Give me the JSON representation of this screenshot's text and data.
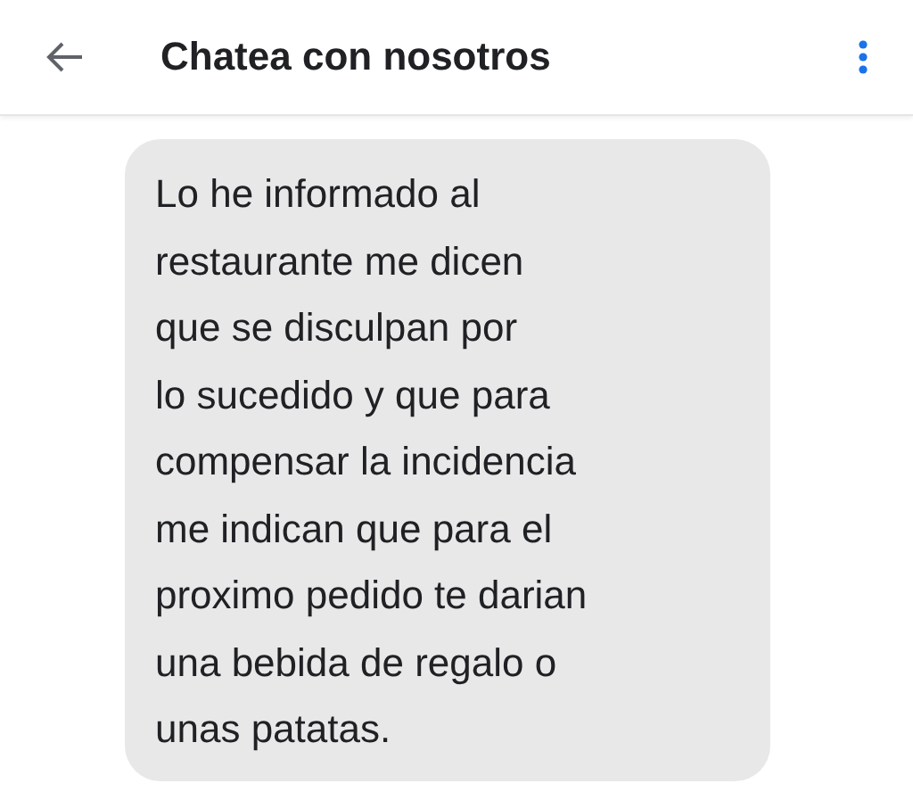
{
  "header": {
    "title": "Chatea con nosotros"
  },
  "messages": [
    {
      "text": "Lo he informado al\nrestaurante me dicen\nque se disculpan por\nlo sucedido y que para\ncompensar la incidencia\nme indican que para el\nproximo pedido te darian\nuna bebida de regalo o\nunas patatas."
    }
  ]
}
